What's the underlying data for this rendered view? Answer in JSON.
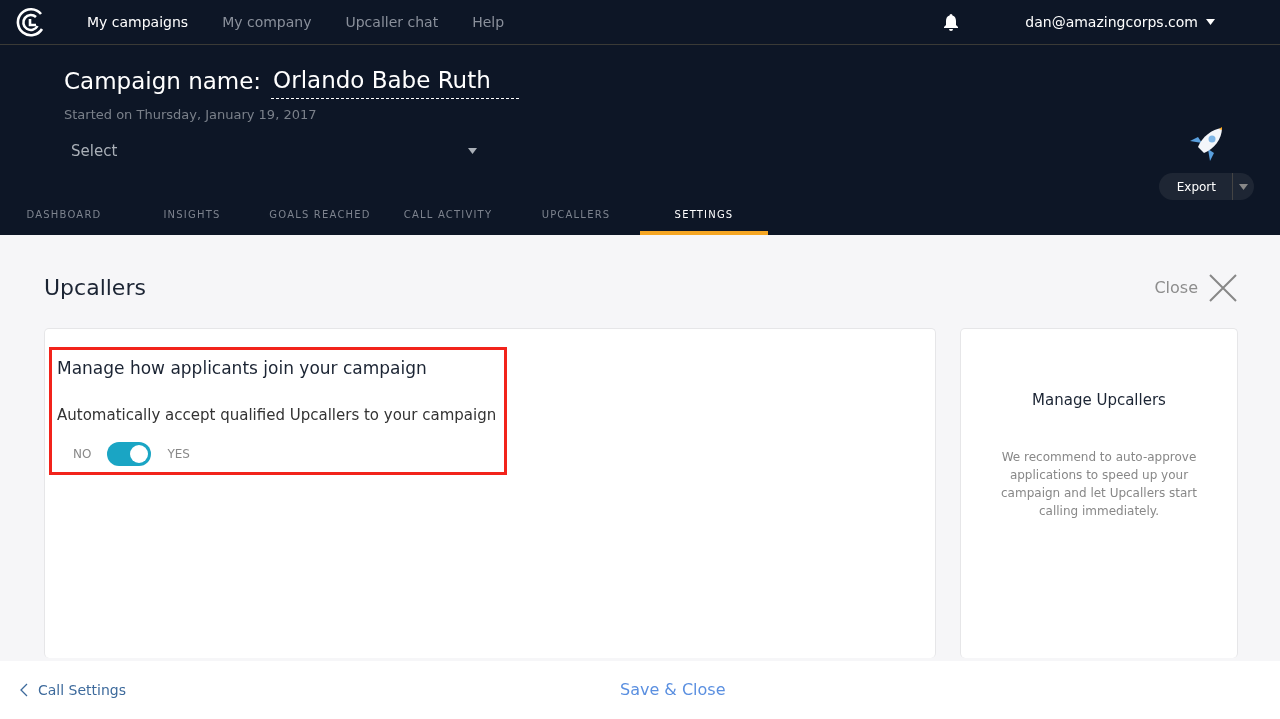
{
  "nav": {
    "items": [
      {
        "label": "My campaigns",
        "selected": true
      },
      {
        "label": "My company",
        "selected": false
      },
      {
        "label": "Upcaller chat",
        "selected": false
      },
      {
        "label": "Help",
        "selected": false
      }
    ],
    "user": "dan@amazingcorps.com"
  },
  "campaign": {
    "label": "Campaign name:",
    "name": "Orlando Babe Ruth",
    "started": "Started on Thursday, January 19, 2017",
    "select": "Select",
    "export": "Export"
  },
  "tabs": [
    {
      "label": "DASHBOARD",
      "selected": false
    },
    {
      "label": "INSIGHTS",
      "selected": false
    },
    {
      "label": "GOALS REACHED",
      "selected": false
    },
    {
      "label": "CALL ACTIVITY",
      "selected": false
    },
    {
      "label": "UPCALLERS",
      "selected": false
    },
    {
      "label": "SETTINGS",
      "selected": true
    }
  ],
  "page": {
    "title": "Upcallers",
    "close": "Close"
  },
  "settings_card": {
    "heading": "Manage how applicants join your campaign",
    "description": "Automatically accept qualified Upcallers to your campaign",
    "toggle": {
      "off_label": "NO",
      "on_label": "YES",
      "on": true
    }
  },
  "side_card": {
    "title": "Manage Upcallers",
    "text": "We recommend to auto-approve applications to speed up your campaign and let Upcallers start calling immediately."
  },
  "footer": {
    "back": "Call Settings",
    "save": "Save & Close"
  }
}
